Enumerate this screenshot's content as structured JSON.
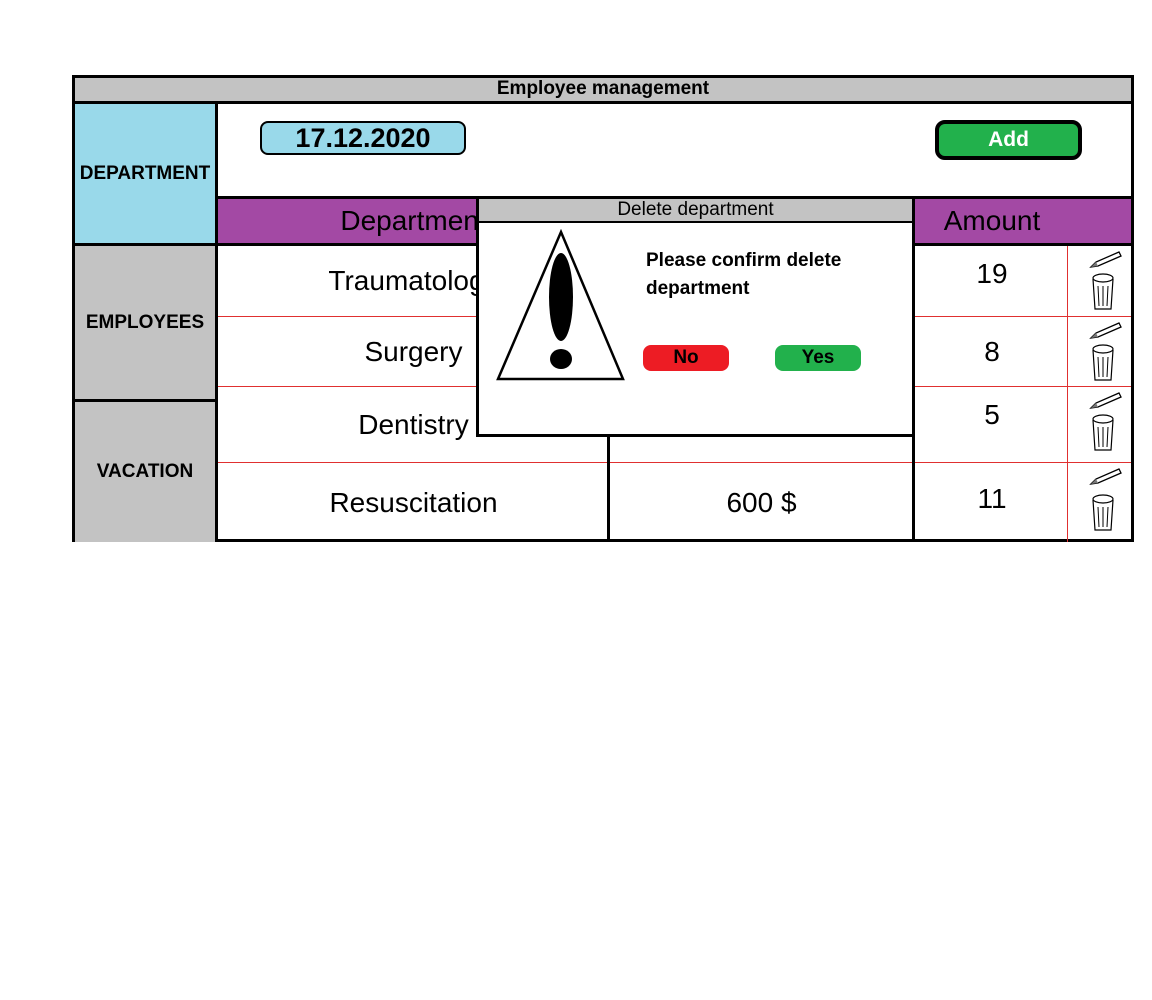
{
  "window": {
    "title": "Employee management"
  },
  "sidebar": {
    "items": [
      {
        "label": "DEPARTMENT",
        "color": "#99d9ea"
      },
      {
        "label": "EMPLOYEES",
        "color": "#c3c3c3"
      },
      {
        "label": "VACATION",
        "color": "#c3c3c3"
      }
    ]
  },
  "toolbar": {
    "date": "17.12.2020",
    "add_label": "Add"
  },
  "table": {
    "columns": [
      "Department",
      "",
      "Amount"
    ],
    "rows": [
      {
        "department": "Traumatology",
        "salary": "",
        "amount": "19"
      },
      {
        "department": "Surgery",
        "salary": "",
        "amount": "8"
      },
      {
        "department": "Dentistry",
        "salary": "",
        "amount": "5"
      },
      {
        "department": "Resuscitation",
        "salary": "600 $",
        "amount": "11"
      }
    ],
    "row_icons": [
      "pencil-icon",
      "trash-icon"
    ]
  },
  "dialog": {
    "title": "Delete department",
    "message": "Please confirm delete department",
    "no_label": "No",
    "yes_label": "Yes",
    "icon": "warning-icon"
  },
  "colors": {
    "header_purple": "#a349a4",
    "accent_blue": "#99d9ea",
    "gray": "#c3c3c3",
    "add_green": "#22b14c",
    "no_red": "#ed1c24"
  }
}
